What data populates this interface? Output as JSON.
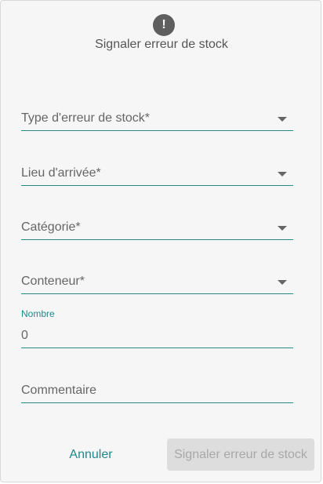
{
  "dialog": {
    "icon": "alert-icon",
    "icon_glyph": "!",
    "title": "Signaler erreur de stock"
  },
  "fields": {
    "stock_error_type": {
      "placeholder": "Type d'erreur de stock*",
      "control": "select"
    },
    "arrival_location": {
      "placeholder": "Lieu d'arrivée*",
      "control": "select"
    },
    "category": {
      "placeholder": "Catégorie*",
      "control": "select"
    },
    "container": {
      "placeholder": "Conteneur*",
      "control": "select"
    },
    "number": {
      "label": "Nombre",
      "value": "0",
      "control": "input"
    },
    "comment": {
      "placeholder": "Commentaire",
      "control": "input"
    }
  },
  "actions": {
    "cancel_label": "Annuler",
    "submit_label": "Signaler erreur de stock"
  },
  "colors": {
    "accent": "#1f8a8a",
    "dialog_background": "#f6f6f6",
    "disabled_button": "#dddddd"
  }
}
